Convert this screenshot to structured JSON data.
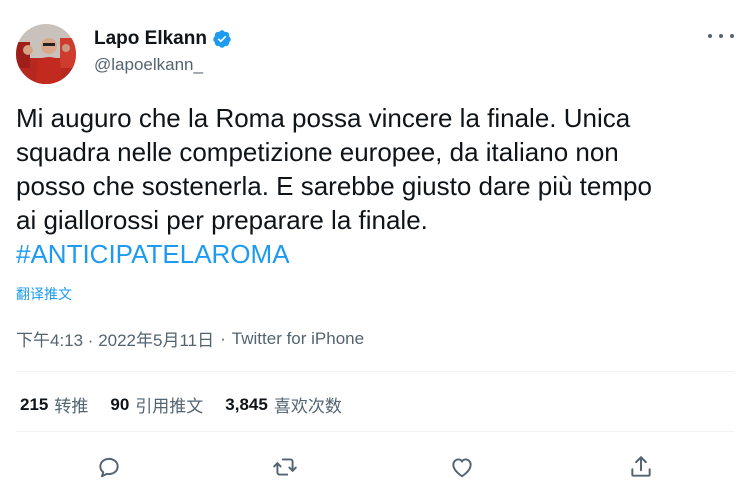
{
  "author": {
    "display_name": "Lapo Elkann",
    "handle": "@lapoelkann_",
    "verified_color": "#1d9bf0"
  },
  "tweet": {
    "lines": [
      "Mi auguro che la Roma possa vincere la finale. Unica",
      "squadra nelle competizione europee, da italiano non",
      "posso che sostenerla. E sarebbe giusto dare più tempo",
      "ai giallorossi per preparare la finale."
    ],
    "hashtag": "#ANTICIPATELAROMA",
    "translate_label": "翻译推文"
  },
  "meta": {
    "time_date": "下午4:13 · 2022年5月11日",
    "separator": "·",
    "source": "Twitter for iPhone"
  },
  "stats": {
    "retweets": {
      "count": "215",
      "label": "转推"
    },
    "quotes": {
      "count": "90",
      "label": "引用推文"
    },
    "likes": {
      "count": "3,845",
      "label": "喜欢次数"
    }
  },
  "icons": {
    "more": "more-dots-icon",
    "reply": "reply-icon",
    "retweet": "retweet-icon",
    "like": "heart-icon",
    "share": "share-icon"
  },
  "colors": {
    "link": "#1d9bf0",
    "text": "#0f1419",
    "secondary": "#536471"
  }
}
